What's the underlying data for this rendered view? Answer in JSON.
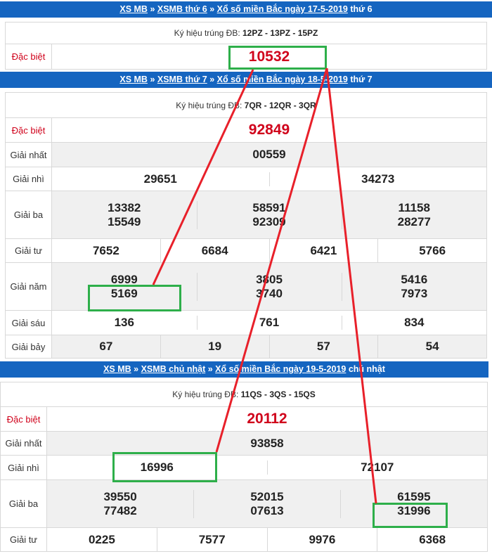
{
  "sections": [
    {
      "header": {
        "xsmb": "XS MB",
        "sep1": " » ",
        "day": "XSMB thứ 6",
        "sep2": " » ",
        "date": "Xổ số miền Bắc ngày 17-5-2019",
        "tail": " thứ 6"
      },
      "symbol_label": "Ký hiệu trúng ĐB: ",
      "symbol_value": "12PZ - 13PZ - 15PZ",
      "special_label": "Đặc biệt",
      "special": "10532"
    },
    {
      "header": {
        "xsmb": "XS MB",
        "sep1": " » ",
        "day": "XSMB thứ 7",
        "sep2": " » ",
        "date": "Xổ số miền Bắc ngày 18-5-2019",
        "tail": " thứ 7"
      },
      "symbol_label": "Ký hiệu trúng ĐB: ",
      "symbol_value": "7QR - 12QR - 3QR",
      "special_label": "Đặc biệt",
      "special": "92849",
      "prizes": {
        "nhat": {
          "label": "Giải nhất",
          "values": [
            "00559"
          ]
        },
        "nhi": {
          "label": "Giải nhì",
          "values": [
            "29651",
            "34273"
          ]
        },
        "ba": {
          "label": "Giải ba",
          "values": [
            "13382",
            "58591",
            "11158",
            "15549",
            "92309",
            "28277"
          ]
        },
        "tu": {
          "label": "Giải tư",
          "values": [
            "7652",
            "6684",
            "6421",
            "5766"
          ]
        },
        "nam": {
          "label": "Giải năm",
          "values": [
            "6999",
            "3805",
            "5416",
            "5169",
            "3740",
            "7973"
          ]
        },
        "sau": {
          "label": "Giải sáu",
          "values": [
            "136",
            "761",
            "834"
          ]
        },
        "bay": {
          "label": "Giải bảy",
          "values": [
            "67",
            "19",
            "57",
            "54"
          ]
        }
      }
    },
    {
      "header": {
        "xsmb": "XS MB",
        "sep1": " » ",
        "day": "XSMB chủ nhật",
        "sep2": " » ",
        "date": "Xổ số miền Bắc ngày 19-5-2019",
        "tail": " chủ nhật"
      },
      "symbol_label": "Ký hiệu trúng ĐB: ",
      "symbol_value": "11QS - 3QS - 15QS",
      "special_label": "Đặc biệt",
      "special": "20112",
      "prizes": {
        "nhat": {
          "label": "Giải nhất",
          "values": [
            "93858"
          ]
        },
        "nhi": {
          "label": "Giải nhì",
          "values": [
            "16996",
            "72107"
          ]
        },
        "ba": {
          "label": "Giải ba",
          "values": [
            "39550",
            "52015",
            "61595",
            "77482",
            "07613",
            "31996"
          ]
        },
        "tu": {
          "label": "Giải tư",
          "values": [
            "0225",
            "7577",
            "9976",
            "6368"
          ]
        }
      }
    }
  ],
  "colors": {
    "header_bg": "#1565c0",
    "special_red": "#d0021b",
    "highlight_green": "#2eaf4a",
    "line_red": "#e8202a"
  }
}
